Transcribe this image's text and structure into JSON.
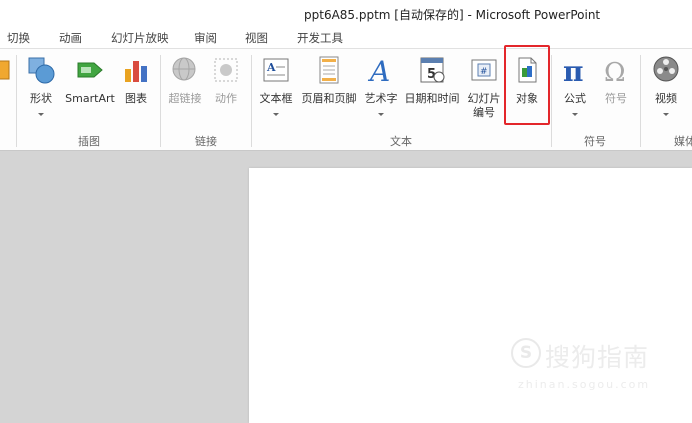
{
  "window": {
    "title": "ppt6A85.pptm [自动保存的] - Microsoft PowerPoint"
  },
  "tabs": [
    "切换",
    "动画",
    "幻灯片放映",
    "审阅",
    "视图",
    "开发工具"
  ],
  "ribbon": {
    "groups": {
      "illustrations": "插图",
      "links": "链接",
      "text": "文本",
      "symbols": "符号",
      "media": "媒体"
    },
    "buttons": {
      "shapes": "形状",
      "smartart": "SmartArt",
      "chart": "图表",
      "hyperlink": "超链接",
      "action": "动作",
      "textbox": "文本框",
      "header_footer": "页眉和页脚",
      "wordart": "艺术字",
      "datetime": "日期和时间",
      "slide_number_1": "幻灯片",
      "slide_number_2": "编号",
      "object": "对象",
      "equation": "公式",
      "symbol": "符号",
      "video": "视频"
    },
    "icons": {
      "shapes": "shapes-icon",
      "smartart": "smartart-icon",
      "chart": "chart-icon",
      "hyperlink": "globe-link-icon",
      "action": "action-icon",
      "textbox": "textbox-icon",
      "header_footer": "header-footer-icon",
      "wordart": "wordart-icon",
      "datetime": "calendar-icon",
      "slide_number": "slide-number-icon",
      "object": "object-icon",
      "equation": "pi-icon",
      "symbol": "omega-icon",
      "video": "film-reel-icon"
    }
  },
  "colors": {
    "highlight": "#e3262b",
    "workspace": "#d4d4d4"
  },
  "watermark": {
    "logo": "S",
    "text": "搜狗指南",
    "url": "zhinan.sogou.com"
  }
}
